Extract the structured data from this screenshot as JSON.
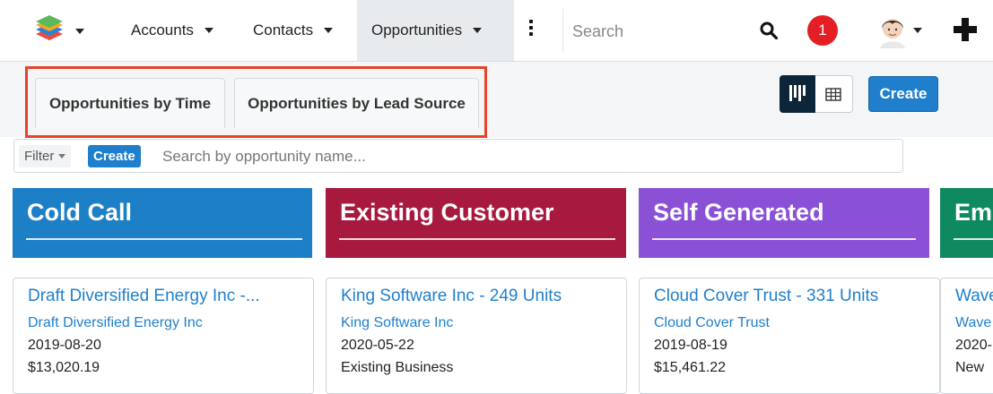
{
  "nav": {
    "items": [
      {
        "label": "Accounts"
      },
      {
        "label": "Contacts"
      },
      {
        "label": "Opportunities"
      }
    ],
    "search_placeholder": "Search",
    "notification_count": "1"
  },
  "tabs": [
    {
      "label": "Opportunities by Time"
    },
    {
      "label": "Opportunities by Lead Source"
    }
  ],
  "toolbar": {
    "create_label": "Create"
  },
  "filter": {
    "label": "Filter",
    "create_label": "Create",
    "search_placeholder": "Search by opportunity name..."
  },
  "columns": [
    {
      "title": "Cold Call",
      "color": "#1d7fc6",
      "card": {
        "title": "Draft Diversified Energy Inc -...",
        "account": "Draft Diversified Energy Inc",
        "line3": "2019-08-20",
        "line4": "$13,020.19"
      }
    },
    {
      "title": "Existing Customer",
      "color": "#a8193f",
      "card": {
        "title": "King Software Inc - 249 Units",
        "account": "King Software Inc",
        "line3": "2020-05-22",
        "line4": "Existing Business"
      }
    },
    {
      "title": "Self Generated",
      "color": "#8a51d6",
      "card": {
        "title": "Cloud Cover Trust - 331 Units",
        "account": "Cloud Cover Trust",
        "line3": "2019-08-19",
        "line4": "$15,461.22"
      }
    },
    {
      "title": "Em",
      "color": "#0f8a60",
      "card": {
        "title": "Wave",
        "account": "Wave",
        "line3": "2020-",
        "line4": "New"
      }
    }
  ],
  "colors": {
    "accent": "#1f7fcd",
    "highlight": "#e8422a",
    "notification": "#e31e24"
  }
}
